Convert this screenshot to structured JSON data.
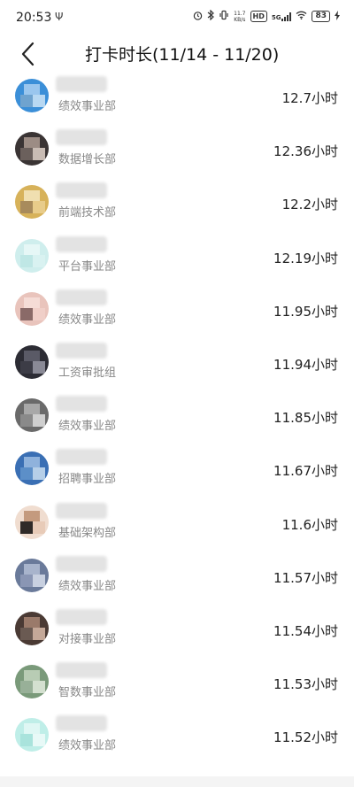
{
  "status_bar": {
    "time": "20:53",
    "usb_icon": "usb-icon",
    "net_speed_value": "11.7",
    "net_speed_unit": "KB/s",
    "hd_label": "HD",
    "signal_label": "5G",
    "battery": "83"
  },
  "header": {
    "back_icon": "chevron-left-icon",
    "title": "打卡时长(11/14 - 11/20)"
  },
  "rows": [
    {
      "dept": "绩效事业部",
      "hours": "12.7小时",
      "avatar_colors": [
        "#3b8fd8",
        "#9ac6ee",
        "#6fa3cf",
        "#b8d8f2"
      ]
    },
    {
      "dept": "数据增长部",
      "hours": "12.36小时",
      "avatar_colors": [
        "#3a3434",
        "#9c8c84",
        "#6b605c",
        "#c9bcb4"
      ]
    },
    {
      "dept": "前端技术部",
      "hours": "12.2小时",
      "avatar_colors": [
        "#d7b25a",
        "#f0dfb0",
        "#a88b5c",
        "#e8cc8a"
      ]
    },
    {
      "dept": "平台事业部",
      "hours": "12.19小时",
      "avatar_colors": [
        "#cfeeed",
        "#e6f7f6",
        "#bfe7e5",
        "#d9f2f1"
      ]
    },
    {
      "dept": "绩效事业部",
      "hours": "11.95小时",
      "avatar_colors": [
        "#e9c4bc",
        "#f5dcd6",
        "#8a6a68",
        "#f0cfc8"
      ]
    },
    {
      "dept": "工资审批组",
      "hours": "11.94小时",
      "avatar_colors": [
        "#2c2c34",
        "#5a5a66",
        "#3c3c46",
        "#8a8a96"
      ]
    },
    {
      "dept": "绩效事业部",
      "hours": "11.85小时",
      "avatar_colors": [
        "#6a6a6a",
        "#a8a8a8",
        "#8a8a8a",
        "#cfcfcf"
      ]
    },
    {
      "dept": "招聘事业部",
      "hours": "11.67小时",
      "avatar_colors": [
        "#3a6fb4",
        "#8fb2dc",
        "#5c8fc8",
        "#b6cfe8"
      ]
    },
    {
      "dept": "基础架构部",
      "hours": "11.6小时",
      "avatar_colors": [
        "#f0ddd0",
        "#c49a7e",
        "#2f2a28",
        "#e8cbb8"
      ]
    },
    {
      "dept": "绩效事业部",
      "hours": "11.57小时",
      "avatar_colors": [
        "#6a7a9a",
        "#a8b4cc",
        "#8a96b4",
        "#c8d0e0"
      ]
    },
    {
      "dept": "对接事业部",
      "hours": "11.54小时",
      "avatar_colors": [
        "#4a3a34",
        "#9a7a6a",
        "#6a5a52",
        "#c4a898"
      ]
    },
    {
      "dept": "智数事业部",
      "hours": "11.53小时",
      "avatar_colors": [
        "#7a9a7a",
        "#b8ccb4",
        "#98b098",
        "#d4e0d0"
      ]
    },
    {
      "dept": "绩效事业部",
      "hours": "11.52小时",
      "avatar_colors": [
        "#bfeee8",
        "#dff7f4",
        "#a9e3dc",
        "#e8f9f7"
      ]
    }
  ]
}
